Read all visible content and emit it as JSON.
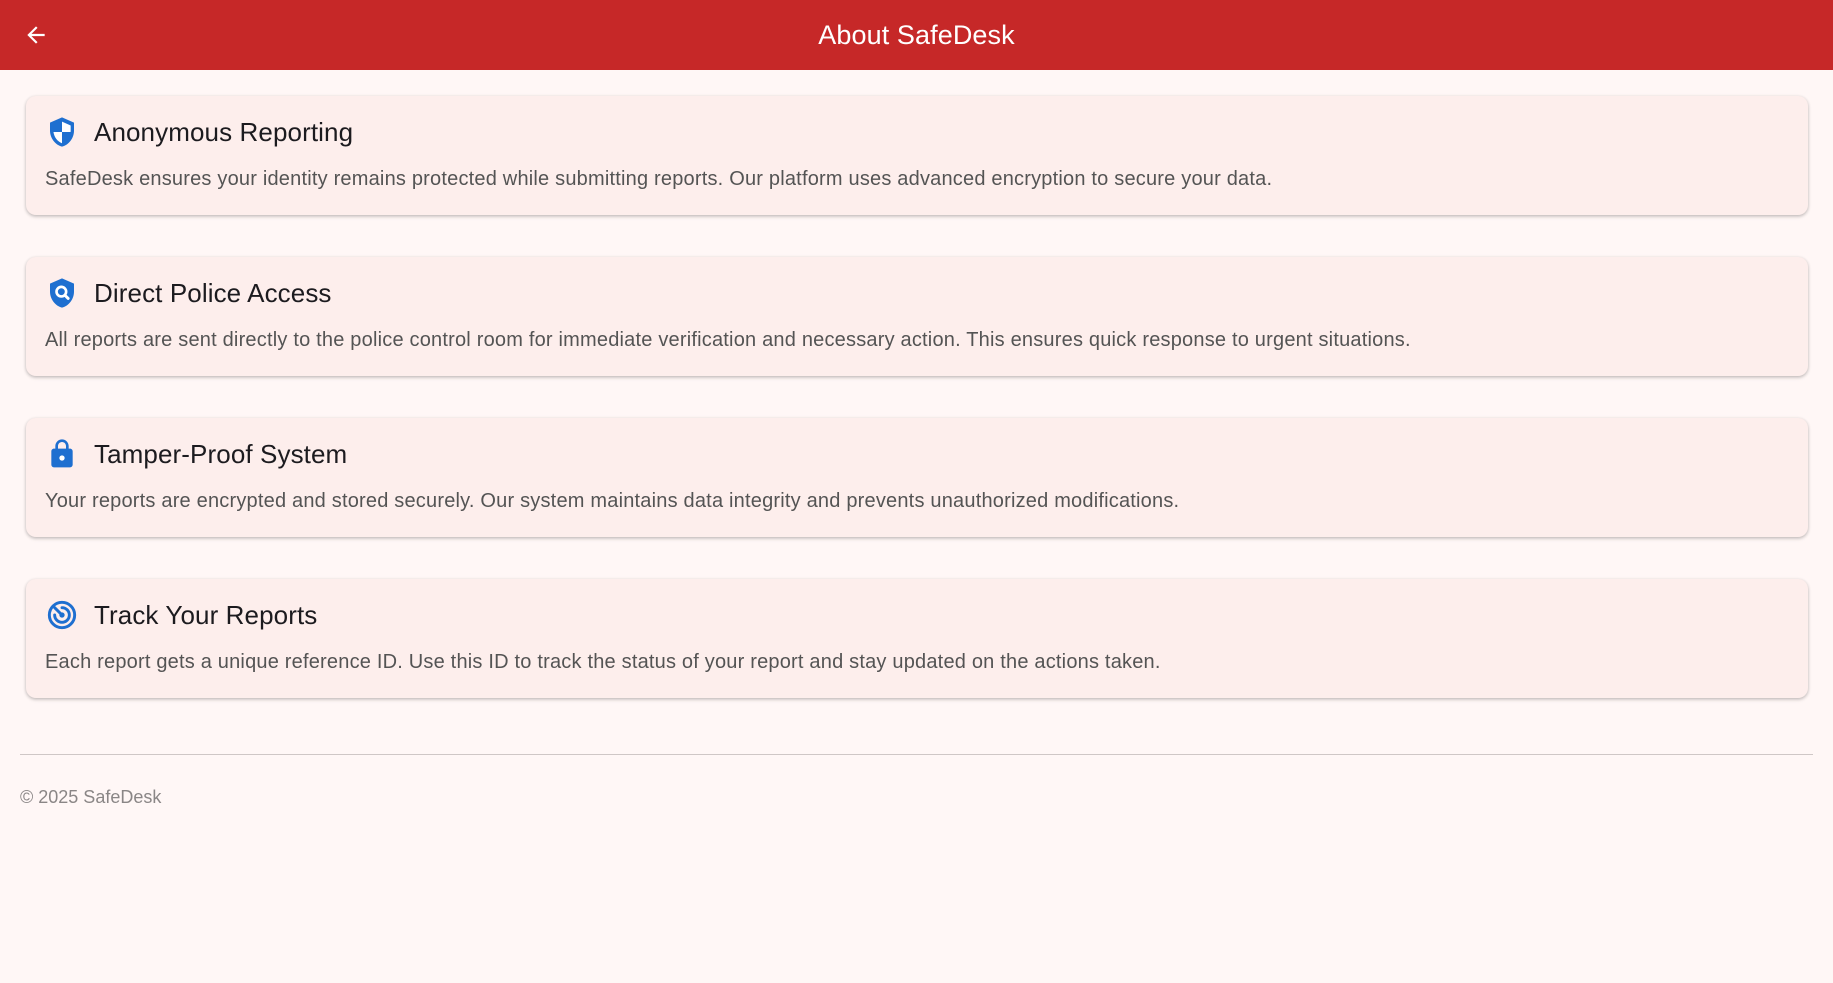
{
  "header": {
    "title": "About SafeDesk",
    "back_icon": "arrow-back-icon"
  },
  "colors": {
    "appbar": "#c62828",
    "icon_accent": "#1e6fd0",
    "card_bg": "#fdeeec",
    "page_bg": "#fff7f6"
  },
  "cards": [
    {
      "icon": "shield-icon",
      "title": "Anonymous Reporting",
      "description": "SafeDesk ensures your identity remains protected while submitting reports. Our platform uses advanced encryption to secure your data."
    },
    {
      "icon": "shield-search-icon",
      "title": "Direct Police Access",
      "description": "All reports are sent directly to the police control room for immediate verification and necessary action. This ensures quick response to urgent situations."
    },
    {
      "icon": "lock-icon",
      "title": "Tamper-Proof System",
      "description": "Your reports are encrypted and stored securely. Our system maintains data integrity and prevents unauthorized modifications."
    },
    {
      "icon": "track-radar-icon",
      "title": "Track Your Reports",
      "description": "Each report gets a unique reference ID. Use this ID to track the status of your report and stay updated on the actions taken."
    }
  ],
  "footer": {
    "copyright": "© 2025 SafeDesk"
  }
}
